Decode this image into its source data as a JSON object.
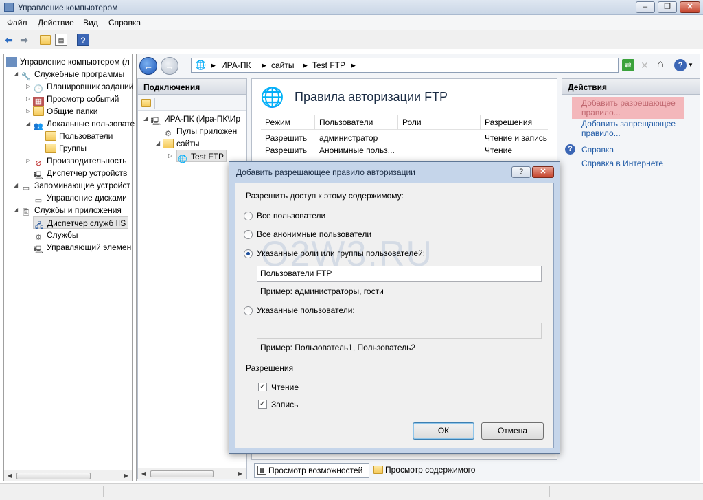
{
  "window": {
    "title": "Управление компьютером"
  },
  "menu": [
    "Файл",
    "Действие",
    "Вид",
    "Справка"
  ],
  "tree": {
    "root": "Управление компьютером (л",
    "items": [
      {
        "label": "Служебные программы"
      },
      {
        "label": "Планировщик заданий"
      },
      {
        "label": "Просмотр событий"
      },
      {
        "label": "Общие папки"
      },
      {
        "label": "Локальные пользовате"
      },
      {
        "label": "Пользователи"
      },
      {
        "label": "Группы"
      },
      {
        "label": "Производительность"
      },
      {
        "label": "Диспетчер устройств"
      },
      {
        "label": "Запоминающие устройст"
      },
      {
        "label": "Управление дисками"
      },
      {
        "label": "Службы и приложения"
      },
      {
        "label": "Диспетчер служб IIS"
      },
      {
        "label": "Службы"
      },
      {
        "label": "Управляющий элемен"
      }
    ]
  },
  "address": {
    "parts": [
      "ИРА-ПК",
      "сайты",
      "Test FTP"
    ]
  },
  "connections": {
    "header": "Подключения",
    "items": [
      "ИРА-ПК (Ира-ПК\\Ир",
      "Пулы приложен",
      "сайты",
      "Test FTP"
    ]
  },
  "feature": {
    "title": "Правила авторизации FTP",
    "columns": [
      "Режим",
      "Пользователи",
      "Роли",
      "Разрешения"
    ],
    "rows": [
      [
        "Разрешить",
        "администратор",
        "",
        "Чтение и запись"
      ],
      [
        "Разрешить",
        "Анонимные польз...",
        "",
        "Чтение"
      ]
    ],
    "tabs": [
      "Просмотр возможностей",
      "Просмотр содержимого"
    ]
  },
  "actions": {
    "header": "Действия",
    "add_allow": "Добавить разрешающее правило...",
    "add_deny": "Добавить запрещающее правило...",
    "help": "Справка",
    "help_online": "Справка в Интернете"
  },
  "dialog": {
    "title": "Добавить разрешающее правило авторизации",
    "help_btn": "?",
    "prompt": "Разрешить доступ к этому содержимому:",
    "opt_all": "Все пользователи",
    "opt_anon": "Все анонимные пользователи",
    "opt_roles": "Указанные роли или группы пользователей:",
    "roles_value": "Пользователи FTP",
    "roles_example": "Пример: администраторы, гости",
    "opt_users": "Указанные пользователи:",
    "users_value": "",
    "users_example": "Пример: Пользователь1, Пользователь2",
    "perm_header": "Разрешения",
    "perm_read": "Чтение",
    "perm_write": "Запись",
    "ok": "ОК",
    "cancel": "Отмена",
    "watermark": "Q2W3.RU"
  }
}
